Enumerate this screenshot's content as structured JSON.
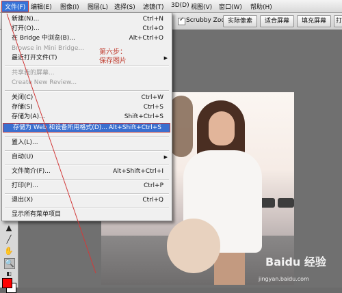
{
  "menubar": {
    "items": [
      "文件(F)",
      "编辑(E)",
      "图像(I)",
      "图层(L)",
      "选择(S)",
      "滤镜(T)",
      "3D(D)",
      "视图(V)",
      "窗口(W)",
      "帮助(H)"
    ]
  },
  "options_bar": {
    "scrubby_zoom": "Scrubby Zoom",
    "btn_actual_pixels": "实际像素",
    "btn_fit_screen": "适合屏幕",
    "btn_fill_screen": "填充屏幕",
    "btn_print_size": "打印尺"
  },
  "file_menu": {
    "items": [
      {
        "label": "新建(N)...",
        "shortcut": "Ctrl+N"
      },
      {
        "label": "打开(O)...",
        "shortcut": "Ctrl+O"
      },
      {
        "label": "在 Bridge 中浏览(B)...",
        "shortcut": "Alt+Ctrl+O"
      },
      {
        "label": "Browse in Mini Bridge...",
        "shortcut": ""
      },
      {
        "label": "最近打开文件(T)",
        "shortcut": ""
      },
      {
        "label": "共享我的屏幕...",
        "shortcut": ""
      },
      {
        "label": "Create New Review...",
        "shortcut": ""
      },
      {
        "label": "关闭(C)",
        "shortcut": "Ctrl+W"
      },
      {
        "label": "存储(S)",
        "shortcut": "Ctrl+S"
      },
      {
        "label": "存储为(A)...",
        "shortcut": "Shift+Ctrl+S"
      },
      {
        "label": "存储为 Web 和设备所用格式(D)...",
        "shortcut": "Alt+Shift+Ctrl+S"
      },
      {
        "label": "置入(L)...",
        "shortcut": ""
      },
      {
        "label": "自动(U)",
        "shortcut": ""
      },
      {
        "label": "文件简介(F)...",
        "shortcut": "Alt+Shift+Ctrl+I"
      },
      {
        "label": "打印(P)...",
        "shortcut": "Ctrl+P"
      },
      {
        "label": "退出(X)",
        "shortcut": "Ctrl+Q"
      },
      {
        "label": "显示所有菜单项目",
        "shortcut": ""
      }
    ]
  },
  "annotation": {
    "line1": "第六步：",
    "line2": "保存图片"
  },
  "watermark": {
    "brand": "Baidu 经验",
    "url": "jingyan.baidu.com"
  },
  "colors": {
    "highlight": "#3a6fd0",
    "annotation": "#c0392b",
    "foreground_swatch": "#ff0000",
    "background_swatch": "#ffffff"
  }
}
